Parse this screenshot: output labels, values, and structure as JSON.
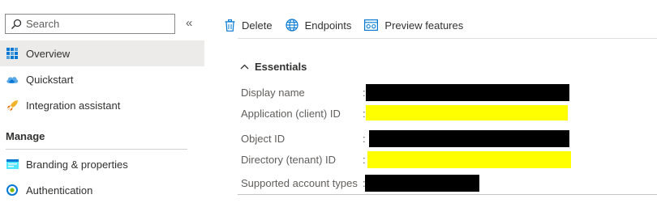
{
  "sidebar": {
    "search_placeholder": "Search",
    "collapse_glyph": "«",
    "items": [
      {
        "label": "Overview",
        "icon": "overview-grid-icon",
        "active": true
      },
      {
        "label": "Quickstart",
        "icon": "cloud-icon"
      },
      {
        "label": "Integration assistant",
        "icon": "rocket-icon"
      }
    ],
    "section_title": "Manage",
    "manage_items": [
      {
        "label": "Branding & properties",
        "icon": "branding-icon"
      },
      {
        "label": "Authentication",
        "icon": "authentication-icon"
      }
    ]
  },
  "toolbar": {
    "delete_label": "Delete",
    "endpoints_label": "Endpoints",
    "preview_label": "Preview features"
  },
  "essentials": {
    "title": "Essentials",
    "rows": [
      {
        "label": "Display name",
        "separator": ":",
        "value_redaction": "black"
      },
      {
        "label": "Application (client) ID",
        "separator": ":",
        "value_redaction": "yellow"
      },
      {
        "label": "Object ID",
        "separator": ":",
        "value_redaction": "black"
      },
      {
        "label": "Directory (tenant) ID",
        "separator": ":",
        "value_redaction": "yellow"
      },
      {
        "label": "Supported account types",
        "separator": ":",
        "value_redaction": "black"
      }
    ]
  },
  "colors": {
    "accent": "#0078d4",
    "active_bg": "#edebe9",
    "redact_black": "#000000",
    "redact_yellow": "#ffff00"
  }
}
